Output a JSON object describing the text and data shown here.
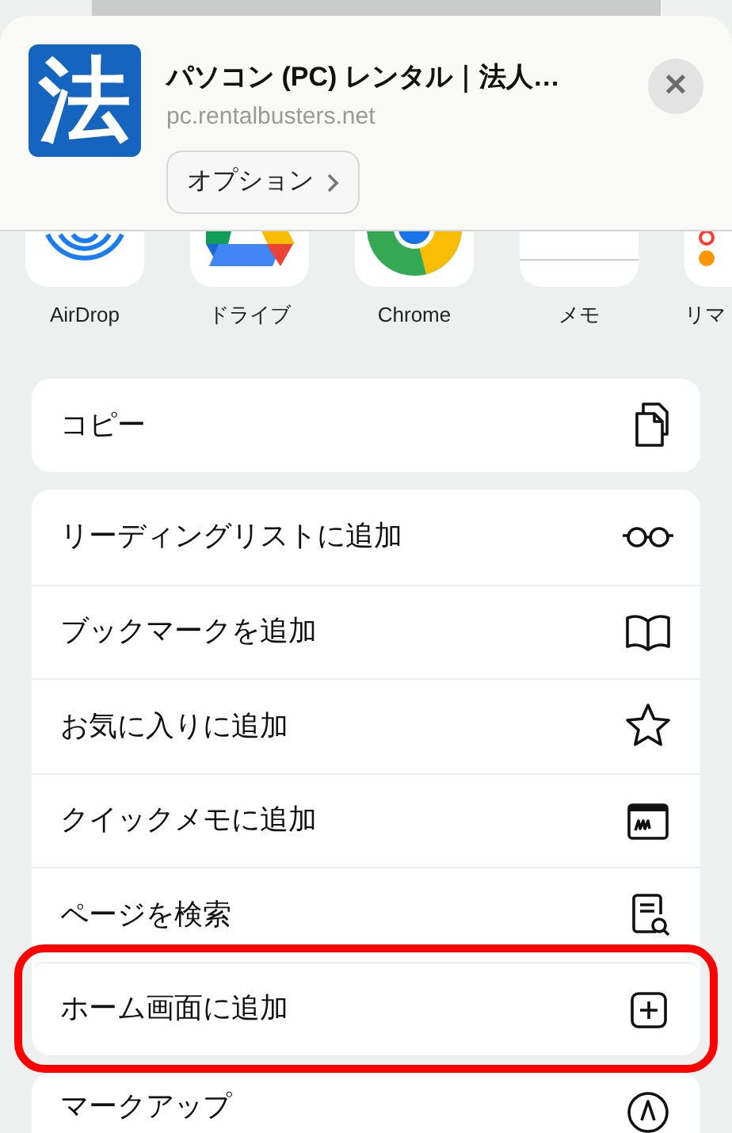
{
  "header": {
    "logo_char": "法",
    "title": "パソコン (PC) レンタル｜法人…",
    "url": "pc.rentalbusters.net",
    "options_button": "オプション",
    "close_symbol": "✕"
  },
  "apps": [
    {
      "kind": "airdrop",
      "label": "AirDrop"
    },
    {
      "kind": "drive",
      "label": "ドライブ"
    },
    {
      "kind": "chrome",
      "label": "Chrome"
    },
    {
      "kind": "memo",
      "label": "メモ"
    },
    {
      "kind": "reminders",
      "label": "リマ"
    }
  ],
  "action_groups": [
    [
      {
        "kind": "copy",
        "label": "コピー",
        "highlighted": false
      }
    ],
    [
      {
        "kind": "glasses",
        "label": "リーディングリストに追加",
        "highlighted": false
      },
      {
        "kind": "book",
        "label": "ブックマークを追加",
        "highlighted": false
      },
      {
        "kind": "star",
        "label": "お気に入りに追加",
        "highlighted": false
      },
      {
        "kind": "quicknote",
        "label": "クイックメモに追加",
        "highlighted": false
      },
      {
        "kind": "findpage",
        "label": "ページを検索",
        "highlighted": false
      },
      {
        "kind": "addhome",
        "label": "ホーム画面に追加",
        "highlighted": true
      }
    ],
    [
      {
        "kind": "markup",
        "label": "マークアップ",
        "highlighted": false
      }
    ]
  ]
}
